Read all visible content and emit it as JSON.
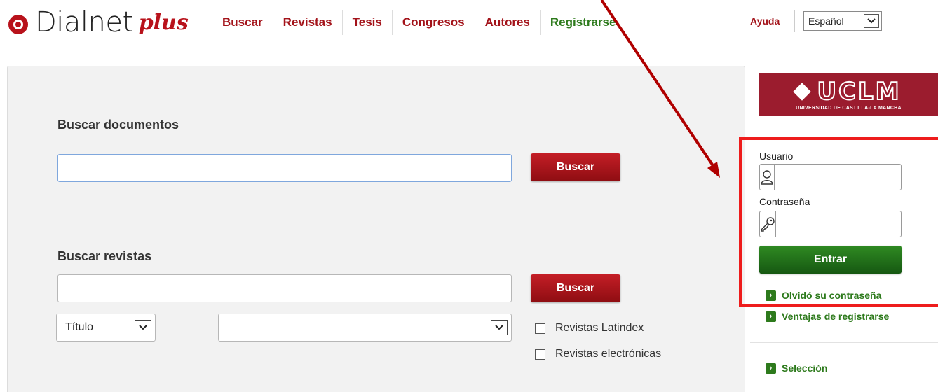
{
  "logo": {
    "wordmark": "Dialnet",
    "plus": "plus"
  },
  "nav": {
    "items": [
      {
        "pre": "",
        "ul": "B",
        "post": "uscar",
        "style": "red"
      },
      {
        "pre": "",
        "ul": "R",
        "post": "evistas",
        "style": "red"
      },
      {
        "pre": "",
        "ul": "T",
        "post": "esis",
        "style": "red"
      },
      {
        "pre": "C",
        "ul": "o",
        "post": "ngresos",
        "style": "red"
      },
      {
        "pre": "A",
        "ul": "u",
        "post": "tores",
        "style": "red"
      },
      {
        "pre": "Re",
        "ul": "g",
        "post": "istrarse",
        "style": "green"
      }
    ]
  },
  "header": {
    "help": "Ayuda",
    "language": "Español"
  },
  "documents": {
    "title": "Buscar documentos",
    "query": "",
    "button": "Buscar"
  },
  "journals": {
    "title": "Buscar revistas",
    "query": "",
    "button": "Buscar",
    "field_select": "Título",
    "second_select": "",
    "checkboxes": [
      {
        "label": "Revistas Latindex",
        "checked": false
      },
      {
        "label": "Revistas electrónicas",
        "checked": false
      }
    ]
  },
  "institution": {
    "name": "UCLM",
    "subtitle": "UNIVERSIDAD DE CASTILLA-LA MANCHA"
  },
  "login": {
    "user_label": "Usuario",
    "user_value": "",
    "password_label": "Contraseña",
    "password_value": "",
    "submit": "Entrar",
    "forgot": "Olvidó su contraseña"
  },
  "side_links": {
    "register_benefits": "Ventajas de registrarse",
    "selection": "Selección"
  },
  "colors": {
    "brand_red": "#a3131a",
    "brand_green": "#2d7a1c",
    "highlight_red": "#ee1c1c",
    "arrow_red": "#b00000"
  }
}
